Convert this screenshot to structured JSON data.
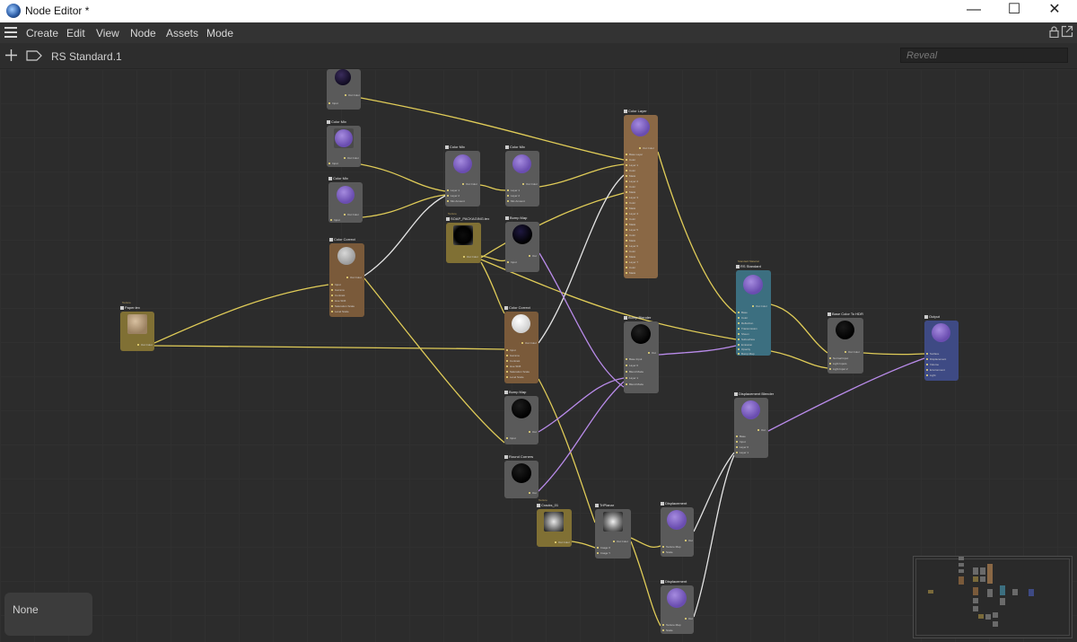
{
  "window": {
    "title": "Node Editor *",
    "minimize_glyph": "—",
    "maximize_glyph": "☐",
    "close_glyph": "✕",
    "app_icon": "cinema4d-logo-icon"
  },
  "menu": {
    "items": [
      "Create",
      "Edit",
      "View",
      "Node",
      "Assets",
      "Mode"
    ],
    "icons": [
      "hamburger-icon",
      "lock-icon",
      "popout-icon"
    ]
  },
  "pathbar": {
    "path": "RS Standard.1",
    "search_placeholder": "Reveal"
  },
  "selection_panel": {
    "label": "None"
  },
  "colors": {
    "canvas": "#2c2c2c",
    "wire_color": "#e0cc58",
    "wire_vector": "#b98bea",
    "wire_white": "#e4e4e4",
    "node_gray": "#5a5a5a",
    "node_brown": "#7a5a3a",
    "node_ochre": "#807034",
    "node_teal": "#3c6f80",
    "node_blue": "#3e4a84"
  },
  "nodes": {
    "top_node": {
      "ports": [
        "Out Color",
        "Input"
      ]
    },
    "color_mix_a": {
      "title": "Color Mix",
      "ports": [
        "Out Color",
        "Input"
      ]
    },
    "color_mix_b": {
      "title": "Color Mix",
      "ports": [
        "Out Color",
        "Input"
      ]
    },
    "color_mix_c": {
      "title": "Color Mix",
      "ports": [
        "Out Color",
        "Layer 1",
        "Layer 2",
        "Mix Amount"
      ]
    },
    "color_mix_d": {
      "title": "Color Mix",
      "ports": [
        "Out Color",
        "Layer 1",
        "Layer 2",
        "Mix Amount"
      ]
    },
    "color_correct_a": {
      "title": "Color Correct",
      "ports": [
        "Out Color",
        "Input",
        "Gamma",
        "Contrast",
        "Hue Shift",
        "Saturation Scale",
        "Level Scale"
      ]
    },
    "texture_paper": {
      "super": "Texture",
      "title": "Paper.tex",
      "ports": [
        "Out Color"
      ]
    },
    "texture_soap": {
      "super": "Texture",
      "title": "SOAP_PACKAGING.tex",
      "ports": [
        "Out Color"
      ]
    },
    "bump_map_a": {
      "title": "Bump Map",
      "ports": [
        "Out",
        "Input"
      ]
    },
    "color_layer": {
      "title": "Color Layer",
      "ports": [
        "Out Color",
        "Base Layer",
        "Color",
        "Layer 1",
        "Color",
        "Mask",
        "Layer 2",
        "Color",
        "Mask",
        "Layer 3",
        "Color",
        "Mask",
        "Layer 4",
        "Color",
        "Mask",
        "Layer 5",
        "Color",
        "Mask",
        "Layer 6",
        "Color",
        "Mask",
        "Layer 7",
        "Color",
        "Mask"
      ]
    },
    "rs_standard": {
      "super": "Standard Material",
      "title": "RS Standard",
      "ports": [
        "Out Color",
        "Base",
        "Color",
        "Reflection",
        "Transmission",
        "Sheen",
        "Subsurface",
        "Emission",
        "Opacity",
        "Bump Map"
      ]
    },
    "color_correct_b": {
      "title": "Color Correct",
      "ports": [
        "Out Color",
        "Input",
        "Gamma",
        "Contrast",
        "Hue Shift",
        "Saturation Scale",
        "Level Scale"
      ]
    },
    "bump_blender": {
      "title": "Bump Blender",
      "ports": [
        "Out",
        "Base Input",
        "Layer 0",
        "Blend Mode",
        "Layer 1",
        "Blend Mode"
      ]
    },
    "base_color_to_hdr": {
      "title": "Base Color To HDR",
      "ports": [
        "Out Color",
        "Normal Input",
        "Light Inputs",
        "Light Input 2"
      ]
    },
    "output": {
      "title": "Output",
      "ports": [
        "Surface",
        "Displacement",
        "Volume",
        "Environment",
        "Light"
      ]
    },
    "bump_map_b": {
      "title": "Bump Map",
      "ports": [
        "Out",
        "Input"
      ]
    },
    "round_corners": {
      "title": "Round Corners",
      "ports": [
        "Out"
      ]
    },
    "displacement_blender": {
      "title": "Displacement Blender",
      "ports": [
        "Out",
        "Base",
        "Input",
        "Layer 0",
        "Layer 1"
      ]
    },
    "texture_cracks": {
      "super": "Texture",
      "title": "Cracks_01",
      "ports": [
        "Out Color"
      ]
    },
    "triplanar": {
      "title": "TriPlanar",
      "ports": [
        "Out Color",
        "Image X",
        "Image Y"
      ]
    },
    "displacement_a": {
      "title": "Displacement",
      "ports": [
        "Out",
        "Texture Map",
        "Scale"
      ]
    },
    "displacement_b": {
      "title": "Displacement",
      "ports": [
        "Out",
        "Texture Map",
        "Scale"
      ]
    }
  }
}
